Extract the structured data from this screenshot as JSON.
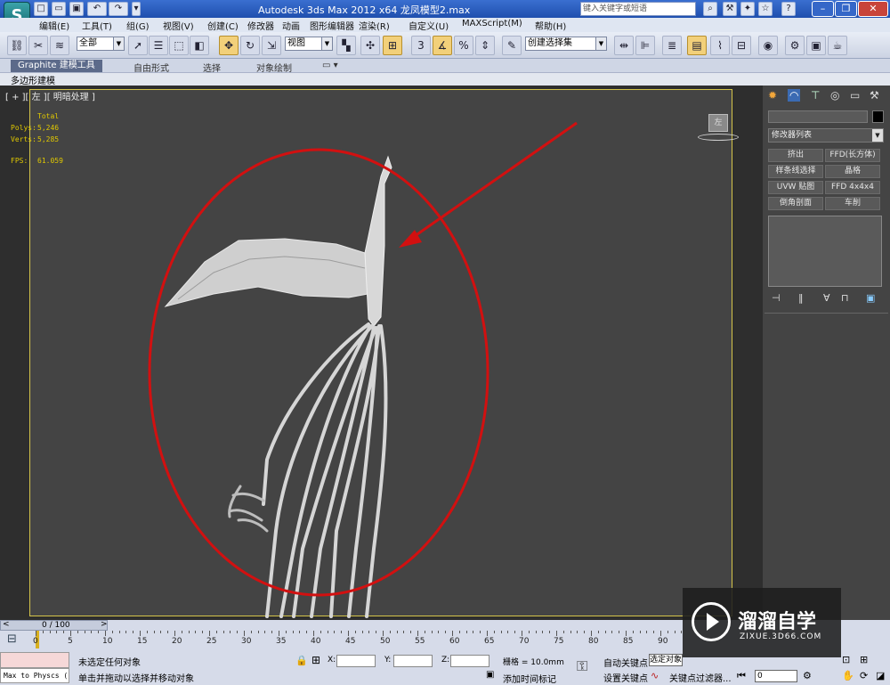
{
  "titlebar": {
    "title": "Autodesk 3ds Max  2012 x64      龙凤模型2.max",
    "search_placeholder": "键入关键字或短语",
    "logo_glyph": "S"
  },
  "menu": [
    "编辑(E)",
    "工具(T)",
    "组(G)",
    "视图(V)",
    "创建(C)",
    "修改器",
    "动画",
    "图形编辑器",
    "渲染(R)",
    "自定义(U)",
    "MAXScript(M)",
    "帮助(H)"
  ],
  "toolbar": {
    "filter_select": "全部",
    "coord_select": "视图",
    "snap_label": "3",
    "percent_label": "%",
    "named_selection": "创建选择集"
  },
  "ribbon": {
    "tabs": [
      "Graphite 建模工具",
      "自由形式",
      "选择",
      "对象绘制"
    ],
    "subtab": "多边形建模"
  },
  "viewport": {
    "label": "[ + ][ 左 ][ 明暗处理 ]",
    "viewcube_label": "左",
    "stats": {
      "header": "Total",
      "polys_label": "Polys:",
      "polys_value": "5,246",
      "verts_label": "Verts:",
      "verts_value": "5,285",
      "fps_label": "FPS:",
      "fps_value": "61.059"
    }
  },
  "command_panel": {
    "modifier_list": "修改器列表",
    "buttons": [
      "挤出",
      "FFD(长方体)",
      "样条线选择",
      "晶格",
      "UVW 贴图",
      "FFD 4x4x4",
      "倒角剖面",
      "车削"
    ]
  },
  "timeline": {
    "frame_display": "0 / 100",
    "ticks": [
      "0",
      "5",
      "10",
      "15",
      "20",
      "25",
      "30",
      "35",
      "40",
      "45",
      "50",
      "55",
      "60",
      "65",
      "70",
      "75",
      "80",
      "85",
      "90"
    ]
  },
  "status": {
    "script_listener": "Max to Physcs (",
    "line1": "未选定任何对象",
    "line2": "单击并拖动以选择并移动对象",
    "x_label": "X:",
    "y_label": "Y:",
    "z_label": "Z:",
    "grid": "栅格 = 10.0mm",
    "add_time_tag": "添加时间标记",
    "auto_key": "自动关键点",
    "set_key": "设置关键点",
    "selected_option": "选定对象",
    "key_filter": "关键点过滤器...",
    "frame_value": "0"
  },
  "watermark": {
    "brand": "溜溜自学",
    "url": "ZIXUE.3D66.COM"
  },
  "colors": {
    "annotation_red": "#d21010",
    "viewport_border": "#d4c44a",
    "stats_yellow": "#e0c800"
  }
}
